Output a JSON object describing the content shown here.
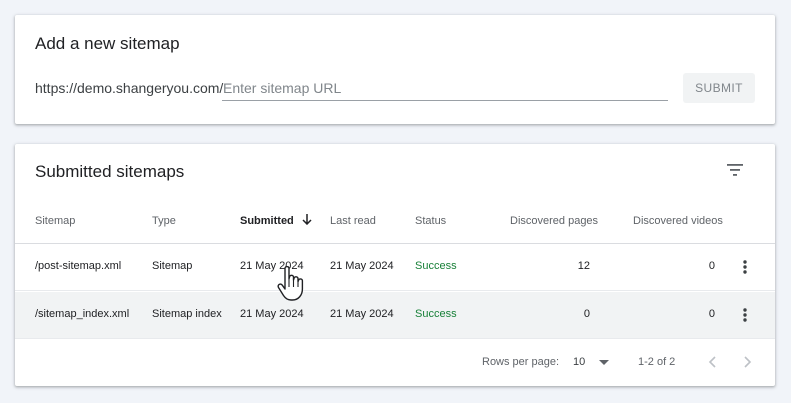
{
  "add_sitemap": {
    "title": "Add a new sitemap",
    "url_prefix": "https://demo.shangeryou.com/",
    "input_value": "",
    "input_placeholder": "Enter sitemap URL",
    "submit_label": "SUBMIT"
  },
  "submitted": {
    "title": "Submitted sitemaps",
    "filter_icon": "filter-icon",
    "columns": {
      "sitemap": "Sitemap",
      "type": "Type",
      "submitted": "Submitted",
      "last_read": "Last read",
      "status": "Status",
      "discovered_pages": "Discovered pages",
      "discovered_videos": "Discovered videos"
    },
    "sort": {
      "column": "submitted",
      "direction": "descending"
    },
    "rows": [
      {
        "sitemap": "/post-sitemap.xml",
        "type": "Sitemap",
        "submitted": "21 May 2024",
        "last_read": "21 May 2024",
        "status": "Success",
        "discovered_pages": "12",
        "discovered_videos": "0"
      },
      {
        "sitemap": "/sitemap_index.xml",
        "type": "Sitemap index",
        "submitted": "21 May 2024",
        "last_read": "21 May 2024",
        "status": "Success",
        "discovered_pages": "0",
        "discovered_videos": "0"
      }
    ],
    "footer": {
      "rows_per_page_label": "Rows per page:",
      "rows_per_page_value": "10",
      "range_text": "1-2 of 2"
    }
  },
  "colors": {
    "background": "#f1f4f9",
    "status_success": "#188038",
    "hover_row": "#f1f3f4"
  }
}
